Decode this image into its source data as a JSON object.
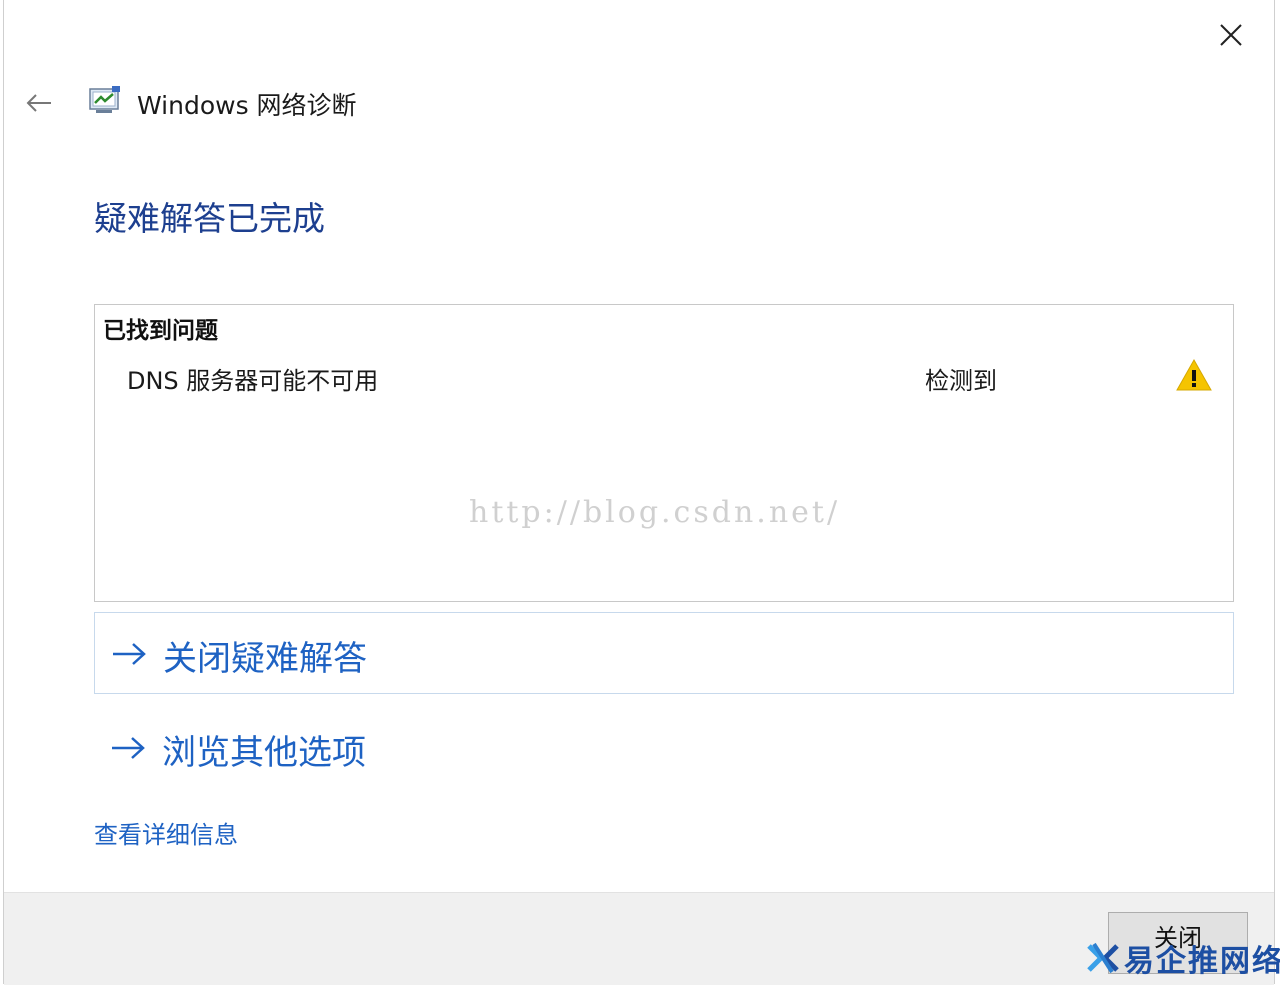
{
  "window": {
    "app_title": "Windows 网络诊断",
    "close_icon": "close-icon",
    "back_icon": "back-arrow-icon",
    "app_icon": "network-diagnostics-icon"
  },
  "main": {
    "heading": "疑难解答已完成",
    "problems_box": {
      "header": "已找到问题",
      "items": [
        {
          "name": "DNS 服务器可能不可用",
          "status": "检测到",
          "icon": "warning-icon"
        }
      ],
      "watermark": "http://blog.csdn.net/"
    },
    "actions": [
      {
        "label": "关闭疑难解答",
        "icon": "arrow-right-icon",
        "selected": true
      },
      {
        "label": "浏览其他选项",
        "icon": "arrow-right-icon",
        "selected": false
      }
    ],
    "details_link": "查看详细信息"
  },
  "footer": {
    "close_button": "关闭"
  },
  "brand": {
    "text": "易企推网络"
  },
  "colors": {
    "heading": "#1d3f8f",
    "link": "#1e62c3",
    "warning": "#f5c400",
    "footer_bg": "#f0f0f0"
  }
}
